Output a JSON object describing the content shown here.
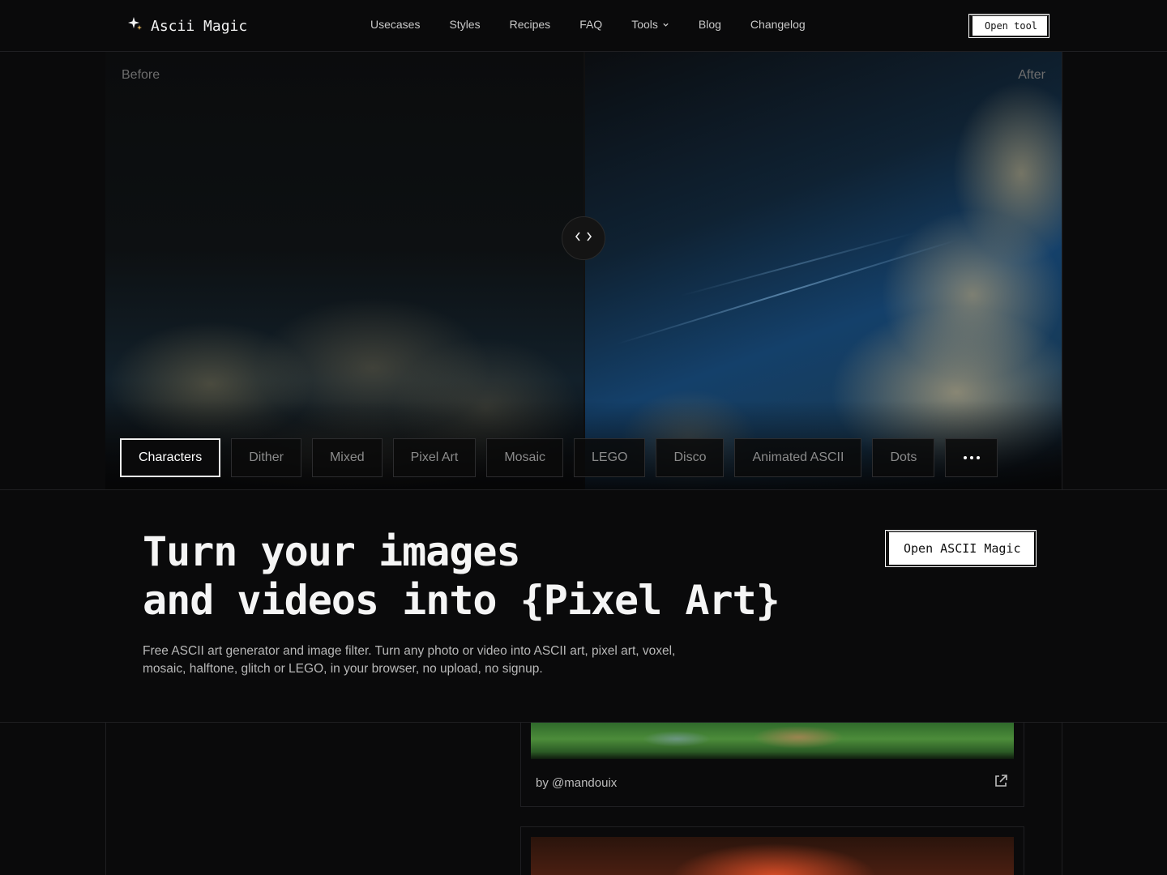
{
  "brand": {
    "name": "Ascii Magic",
    "icon": "sparkle-icon",
    "icon_color": "#e2b25a"
  },
  "nav": {
    "items": [
      {
        "label": "Usecases"
      },
      {
        "label": "Styles"
      },
      {
        "label": "Recipes"
      },
      {
        "label": "FAQ"
      },
      {
        "label": "Tools",
        "icon": "chevron-down-icon"
      },
      {
        "label": "Blog"
      },
      {
        "label": "Changelog"
      }
    ],
    "cta_label": "Open tool"
  },
  "compare": {
    "before_label": "Before",
    "after_label": "After",
    "handle_icons": [
      "chevron-left-icon",
      "chevron-right-icon"
    ]
  },
  "styles": {
    "items": [
      "Characters",
      "Dither",
      "Mixed",
      "Pixel Art",
      "Mosaic",
      "LEGO",
      "Disco",
      "Animated ASCII",
      "Dots"
    ],
    "active": "Characters",
    "more_icon": "more-dots-icon"
  },
  "intro": {
    "headline_line1": "Turn your images",
    "headline_line2": "and videos into {Pixel Art}",
    "subtext": "Free ASCII art generator and image filter. Turn any photo or video into ASCII art, pixel art, voxel, mosaic, halftone, glitch or LEGO, in your browser, no upload, no signup.",
    "cta_label": "Open ASCII Magic"
  },
  "gallery": {
    "cards": [
      {
        "author": "by @mandouix",
        "icon": "external-link-icon"
      },
      {
        "author": ""
      }
    ]
  },
  "colors": {
    "background": "#0a0a0b",
    "border": "#1f1f22",
    "button_bg": "#ffffff"
  }
}
